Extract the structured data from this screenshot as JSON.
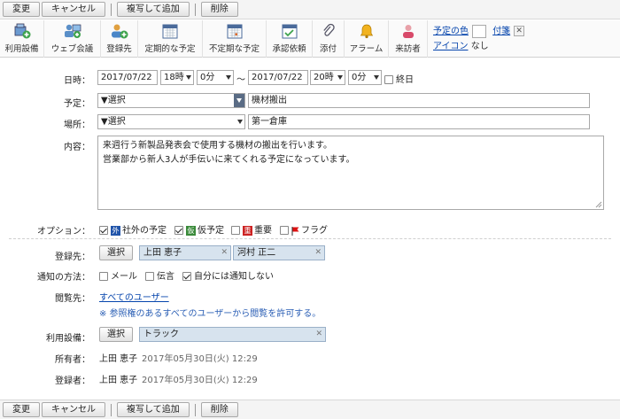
{
  "actions": {
    "change": "変更",
    "cancel": "キャンセル",
    "copy_add": "複写して追加",
    "delete": "削除"
  },
  "toolbar": {
    "items": [
      {
        "label": "利用設備",
        "icon": "facility-icon"
      },
      {
        "label": "ウェブ会議",
        "icon": "web-meeting-icon"
      },
      {
        "label": "登録先",
        "icon": "register-user-icon"
      },
      {
        "label": "定期的な予定",
        "icon": "calendar-repeat-icon"
      },
      {
        "label": "不定期な予定",
        "icon": "calendar-irregular-icon"
      },
      {
        "label": "承認依頼",
        "icon": "approval-icon"
      },
      {
        "label": "添付",
        "icon": "paperclip-icon"
      },
      {
        "label": "アラーム",
        "icon": "bell-icon"
      },
      {
        "label": "来訪者",
        "icon": "visitor-icon"
      }
    ],
    "color_label": "予定の色",
    "sticky_label": "付箋",
    "icon_label": "アイコン",
    "icon_value": "なし"
  },
  "form": {
    "datetime_label": "日時：",
    "start_date": "2017/07/22",
    "start_hour": "18時",
    "start_min": "0分",
    "tilde": "～",
    "end_date": "2017/07/22",
    "end_hour": "20時",
    "end_min": "0分",
    "allday_label": "終日",
    "plan_label": "予定：",
    "plan_select": "▼選択",
    "plan_value": "機材搬出",
    "place_label": "場所：",
    "place_select": "▼選択",
    "place_value": "第一倉庫",
    "content_label": "内容：",
    "content_line1": "来週行う新製品発表会で使用する機材の搬出を行います。",
    "content_line2": "営業部から新人3人が手伝いに来てくれる予定になっています。",
    "option_label": "オプション：",
    "opt_external": "社外の予定",
    "opt_external_tag": "外",
    "opt_tentative": "仮予定",
    "opt_tentative_tag": "仮",
    "opt_important": "重要",
    "opt_important_tag": "重",
    "opt_flag": "フラグ",
    "register_label": "登録先：",
    "select_btn": "選択",
    "register_user1": "上田 恵子",
    "register_user2": "河村 正二",
    "notify_label": "通知の方法：",
    "notify_mail": "メール",
    "notify_message": "伝言",
    "notify_self": "自分には通知しない",
    "viewer_label": "閲覧先：",
    "viewer_value": "すべてのユーザー",
    "viewer_note": "※ 参照権のあるすべてのユーザーから閲覧を許可する。",
    "facility_label": "利用設備：",
    "facility_value": "トラック",
    "owner_label": "所有者：",
    "owner_name": "上田 恵子",
    "owner_time": "2017年05月30日(火) 12:29",
    "registrant_label": "登録者：",
    "registrant_name": "上田 恵子",
    "registrant_time": "2017年05月30日(火) 12:29"
  },
  "colors": {
    "tag_external": "#2255aa",
    "tag_tentative": "#3a8a3a",
    "tag_important": "#cc2222",
    "flag": "#dd1111",
    "chip_bg": "#d7e3ee"
  }
}
